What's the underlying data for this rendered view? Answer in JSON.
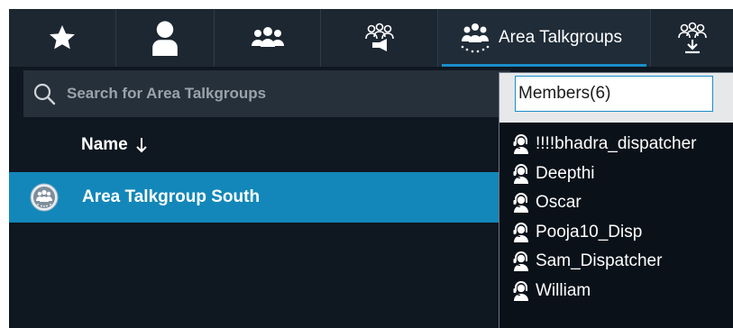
{
  "tabs": [
    {
      "icon": "star-icon"
    },
    {
      "icon": "user-icon"
    },
    {
      "icon": "group-icon"
    },
    {
      "icon": "broadcast-group-icon"
    },
    {
      "icon": "area-talkgroup-icon",
      "label": "Area Talkgroups",
      "active": true
    },
    {
      "icon": "import-group-icon"
    }
  ],
  "search": {
    "placeholder": "Search for Area Talkgroups"
  },
  "list": {
    "column_name": "Name",
    "sort_icon": "arrow-down-icon",
    "rows": [
      {
        "name": "Area Talkgroup South",
        "icon": "area-talkgroup-avatar-icon"
      }
    ]
  },
  "members": {
    "title": "Members(6)",
    "items": [
      {
        "name": "!!!!bhadra_dispatcher"
      },
      {
        "name": "Deepthi"
      },
      {
        "name": "Oscar"
      },
      {
        "name": "Pooja10_Disp"
      },
      {
        "name": "Sam_Dispatcher"
      },
      {
        "name": "William"
      }
    ]
  },
  "colors": {
    "background": "#0f1721",
    "tabbar": "#1d2732",
    "accent": "#1b8ec9",
    "selected_row": "#1387b9",
    "search_bg": "#26303a"
  }
}
